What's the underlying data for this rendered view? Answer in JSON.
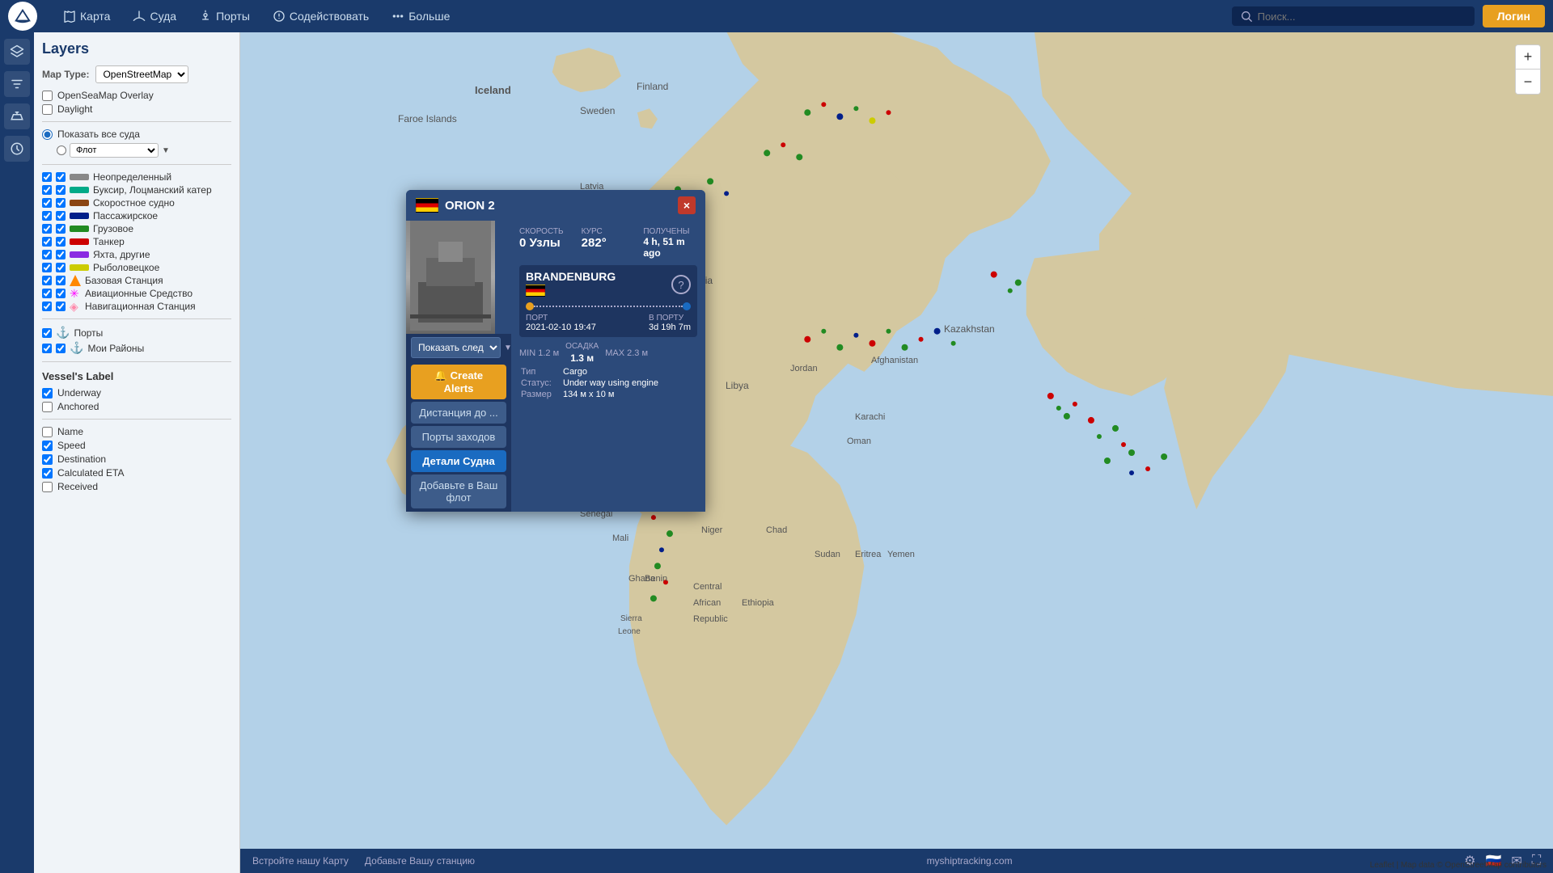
{
  "app": {
    "title": "myshiptracking.com"
  },
  "topnav": {
    "map_label": "Карта",
    "vessels_label": "Суда",
    "ports_label": "Порты",
    "assist_label": "Содействовать",
    "more_label": "Больше",
    "search_placeholder": "Поиск...",
    "login_label": "Логин"
  },
  "leftpanel": {
    "title": "Layers",
    "map_type_label": "Map Type:",
    "map_type_value": "OpenStreetMap",
    "overlay_label": "OpenSeaMap Overlay",
    "daylight_label": "Daylight",
    "show_all_label": "Показать все суда",
    "fleet_label": "Флот",
    "vessel_types": [
      {
        "label": "Неопределенный",
        "color": "#888888",
        "checked": true
      },
      {
        "label": "Буксир, Лоцманский катер",
        "color": "#00aa88",
        "checked": true
      },
      {
        "label": "Скоростное судно",
        "color": "#8B4513",
        "checked": true
      },
      {
        "label": "Пассажирское",
        "color": "#001f8a",
        "checked": true
      },
      {
        "label": "Грузовое",
        "color": "#228B22",
        "checked": true
      },
      {
        "label": "Танкер",
        "color": "#cc0000",
        "checked": true
      },
      {
        "label": "Яхта, другие",
        "color": "#8a2be2",
        "checked": true
      },
      {
        "label": "Рыболовецкое",
        "color": "#cccc00",
        "checked": true
      },
      {
        "label": "Базовая Станция",
        "color": "#ff8800",
        "checked": true
      },
      {
        "label": "Авиационные Средство",
        "color": "#ff00ff",
        "checked": true
      },
      {
        "label": "Навигационная Станция",
        "color": "#ff88aa",
        "checked": true
      }
    ],
    "ports_label": "Порты",
    "my_regions_label": "Мои Районы",
    "vessel_label_section": "Vessel's Label",
    "vessel_labels": [
      {
        "label": "Underway",
        "checked": true
      },
      {
        "label": "Anchored",
        "checked": false
      },
      {
        "label": "Name",
        "checked": false
      },
      {
        "label": "Speed",
        "checked": true
      },
      {
        "label": "Destination",
        "checked": true
      },
      {
        "label": "Calculated ETA",
        "checked": true
      },
      {
        "label": "Received",
        "checked": false
      }
    ]
  },
  "ship_popup": {
    "flag_country": "DE",
    "name": "ORION 2",
    "close_label": "×",
    "speed_label": "Скорость",
    "speed_value": "0 Узлы",
    "course_label": "Курс",
    "course_value": "282°",
    "received_label": "Получены",
    "received_value": "4 h, 51 m ago",
    "destination_name": "BRANDENBURG",
    "port_label": "Порт",
    "port_value": "2021-02-10 19:47",
    "in_port_label": "В ПОРТУ",
    "in_port_value": "3d 19h 7m",
    "min_label": "MIN 1.2 м",
    "max_label": "MAX 2.3 м",
    "draught_label": "Осадка",
    "draught_value": "1.3 м",
    "type_label": "Тип",
    "type_value": "Cargo",
    "status_label": "Статус:",
    "status_value": "Under way using engine",
    "size_label": "Размер",
    "size_value": "134 м x 10 м",
    "show_next_label": "Показать след",
    "btn_create_alerts": "🔔 Create Alerts",
    "btn_distance": "Дистанция до ...",
    "btn_ports": "Порты заходов",
    "btn_details": "Детали Судна",
    "btn_fleet": "Добавьте в Ваш флот"
  },
  "zoom": {
    "plus": "+",
    "minus": "−"
  },
  "bottom": {
    "link1": "Встройте нашу Карту",
    "link2": "Добавьте Вашу станцию",
    "center": "myshiptracking.com",
    "attribution": "Leaflet | Map data © OpenStreetMap contributors"
  }
}
